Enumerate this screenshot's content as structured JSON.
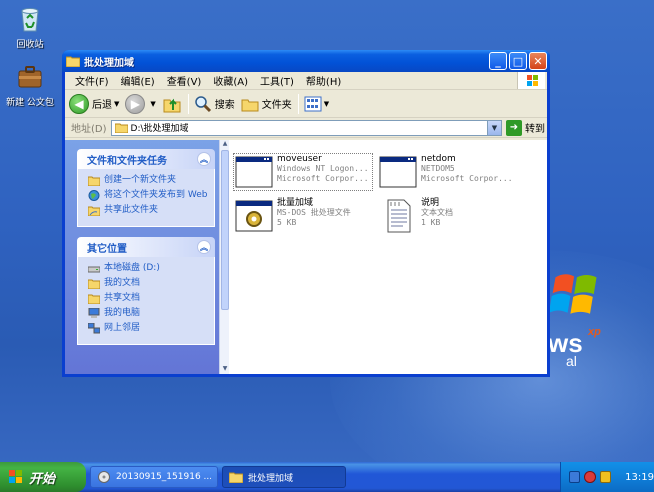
{
  "desktop": {
    "icons": [
      {
        "label": "回收站"
      },
      {
        "label": "新建 公文包"
      }
    ],
    "xp_logo": {
      "w": "ws",
      "xp": "xp",
      "al": "al"
    }
  },
  "window": {
    "title": "批处理加域",
    "controls": {
      "minimize": "_",
      "maximize": "□",
      "close": "✕"
    },
    "menu": [
      "文件(F)",
      "编辑(E)",
      "查看(V)",
      "收藏(A)",
      "工具(T)",
      "帮助(H)"
    ],
    "toolbar": {
      "back": "后退",
      "search": "搜索",
      "folders": "文件夹"
    },
    "address": {
      "label": "地址(D)",
      "value": "D:\\批处理加域",
      "go": "转到"
    },
    "tasks_panel": {
      "title": "文件和文件夹任务",
      "items": [
        "创建一个新文件夹",
        "将这个文件夹发布到 Web",
        "共享此文件夹"
      ]
    },
    "places_panel": {
      "title": "其它位置",
      "items": [
        "本地磁盘 (D:)",
        "我的文档",
        "共享文档",
        "我的电脑",
        "网上邻居"
      ]
    },
    "files": [
      {
        "name": "moveuser",
        "line2": "Windows NT Logon...",
        "line3": "Microsoft Corpor..."
      },
      {
        "name": "netdom",
        "line2": "NETDOM5",
        "line3": "Microsoft Corpor..."
      },
      {
        "name": "批量加域",
        "line2": "MS-DOS 批处理文件",
        "line3": "5 KB"
      },
      {
        "name": "说明",
        "line2": "文本文档",
        "line3": "1 KB"
      }
    ]
  },
  "taskbar": {
    "start": "开始",
    "items": [
      {
        "label": "20130915_151916 ..."
      },
      {
        "label": "批处理加域"
      }
    ],
    "clock": "13:19"
  }
}
